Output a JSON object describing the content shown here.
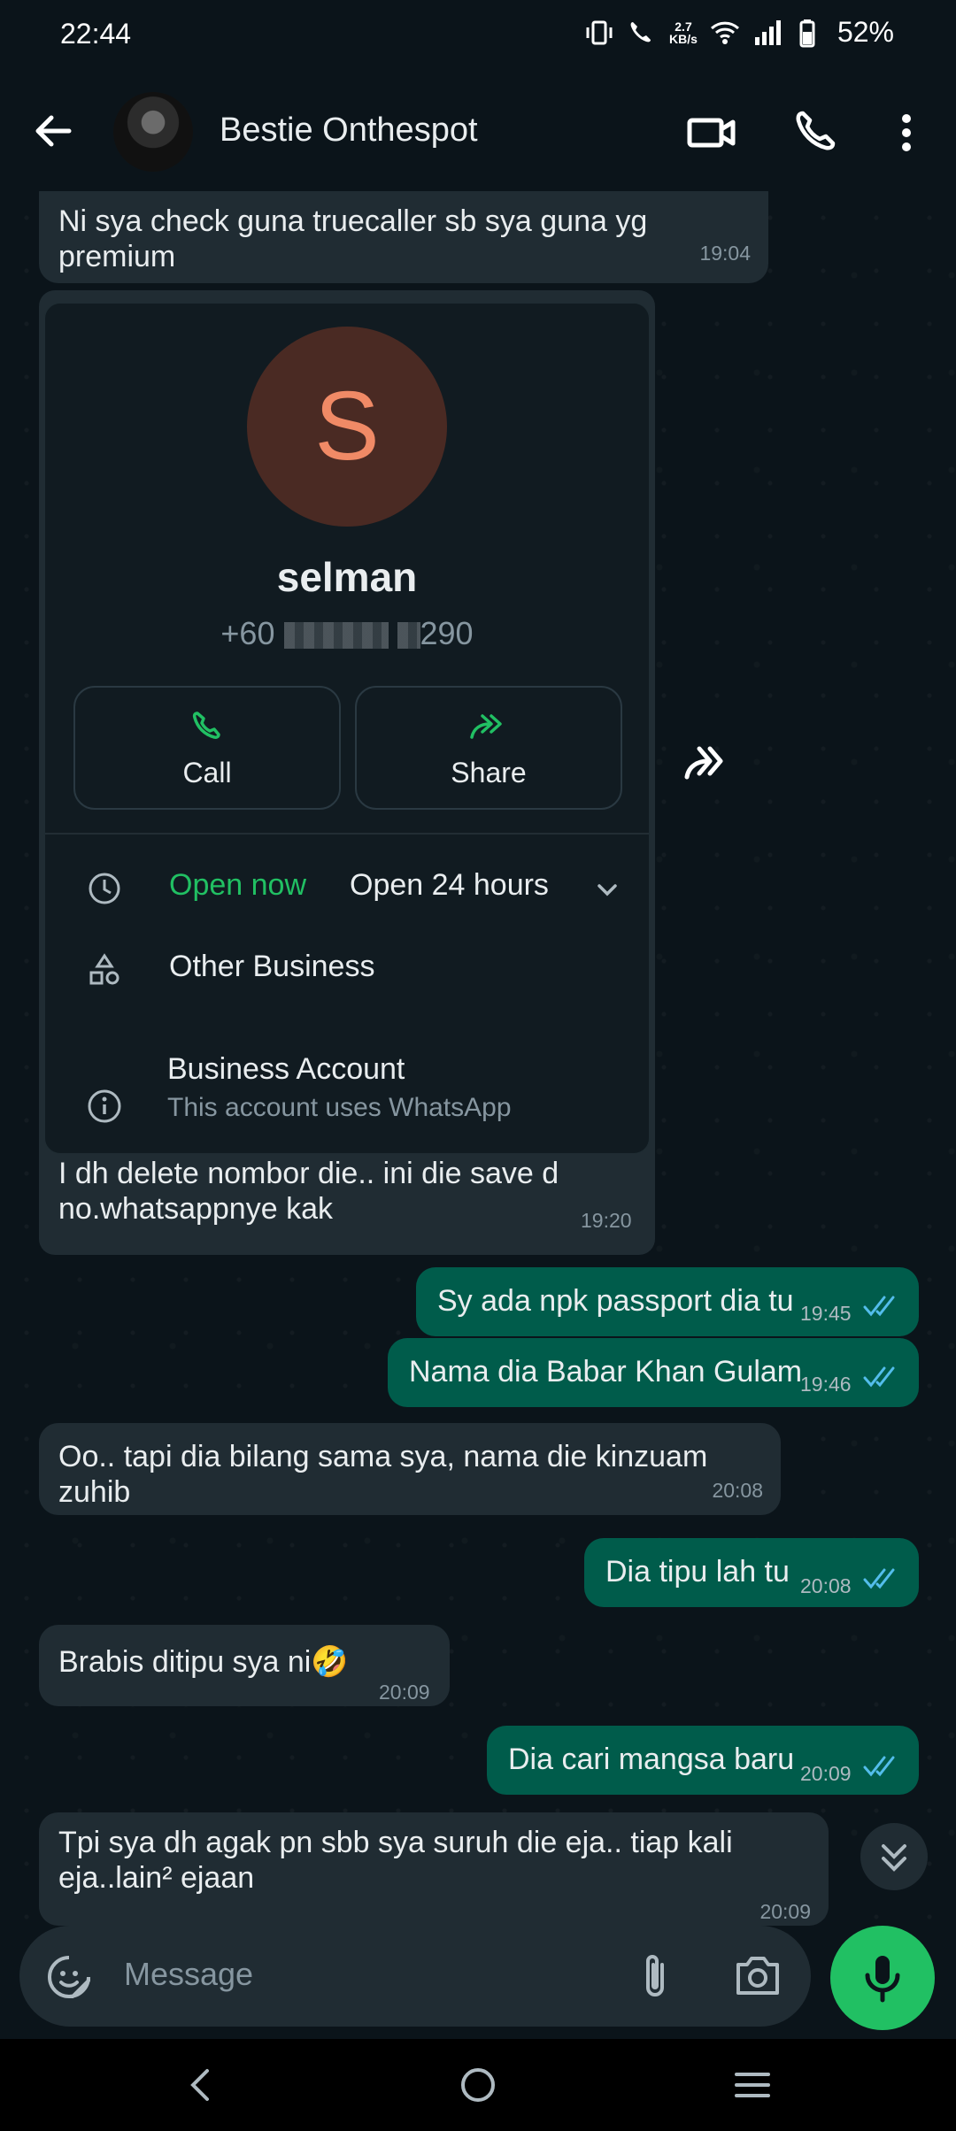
{
  "status_bar": {
    "time": "22:44",
    "net_speed_value": "2.7",
    "net_speed_unit": "KB/s",
    "battery": "52%"
  },
  "header": {
    "contact_name": "Bestie Onthespot",
    "icons": [
      "back-arrow-icon",
      "video-call-icon",
      "voice-call-icon",
      "more-options-icon"
    ]
  },
  "messages": {
    "m1": {
      "text": "Ni sya check guna truecaller sb sya guna yg premium",
      "time": "19:04"
    },
    "card": {
      "avatar_letter": "S",
      "name": "selman",
      "phone_prefix": "+60",
      "phone_suffix": "290",
      "call_label": "Call",
      "share_label": "Share",
      "open_now": "Open now",
      "hours": "Open 24 hours",
      "category": "Other Business",
      "account_title": "Business Account",
      "account_sub": "This account uses WhatsApp"
    },
    "m2": {
      "line1": "I dh delete nombor die.. ini die save d",
      "line2": "no.whatsappnye kak",
      "time": "19:20"
    },
    "m3": {
      "text": "Sy ada npk passport dia tu",
      "time": "19:45"
    },
    "m4": {
      "text": "Nama dia Babar Khan Gulam",
      "time": "19:46"
    },
    "m5": {
      "text": "Oo.. tapi dia bilang sama sya, nama die kinzuam zuhib",
      "time": "20:08"
    },
    "m6": {
      "text": "Dia tipu lah tu",
      "time": "20:08"
    },
    "m7": {
      "text": "Brabis ditipu sya ni",
      "emoji": "🤣",
      "time": "20:09"
    },
    "m8": {
      "text": "Dia cari mangsa baru",
      "time": "20:09"
    },
    "m9": {
      "line1": "Tpi sya dh agak pn sbb sya suruh die eja.. tiap kali",
      "line2": "eja..lain² ejaan",
      "time": "20:09"
    }
  },
  "input": {
    "placeholder": "Message"
  },
  "colors": {
    "background": "#0b141a",
    "incoming_bubble": "#202c33",
    "outgoing_bubble": "#005c4b",
    "accent_green": "#21c063",
    "read_ticks": "#53bdeb"
  }
}
